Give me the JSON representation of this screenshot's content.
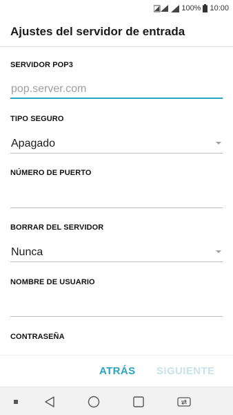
{
  "status_bar": {
    "battery_percent": "100%",
    "time": "10:00"
  },
  "header": {
    "title": "Ajustes del servidor de entrada"
  },
  "form": {
    "pop3_server": {
      "label": "SERVIDOR POP3",
      "value": "",
      "placeholder": "pop.server.com"
    },
    "security_type": {
      "label": "TIPO SEGURO",
      "selected": "Apagado"
    },
    "port_number": {
      "label": "NÚMERO DE PUERTO",
      "value": ""
    },
    "delete_from_server": {
      "label": "BORRAR DEL SERVIDOR",
      "selected": "Nunca"
    },
    "username": {
      "label": "NOMBRE DE USUARIO",
      "value": ""
    },
    "password": {
      "label": "CONTRASEÑA"
    }
  },
  "buttons": {
    "back_label": "ATRÁS",
    "next_label": "SIGUIENTE"
  },
  "colors": {
    "accent": "#27a6c0",
    "disabled_button": "#c8e3ea"
  },
  "nav_bar": {
    "icons": [
      "dot-icon",
      "back-triangle-icon",
      "home-circle-icon",
      "recents-square-icon",
      "switch-sim-icon"
    ]
  }
}
